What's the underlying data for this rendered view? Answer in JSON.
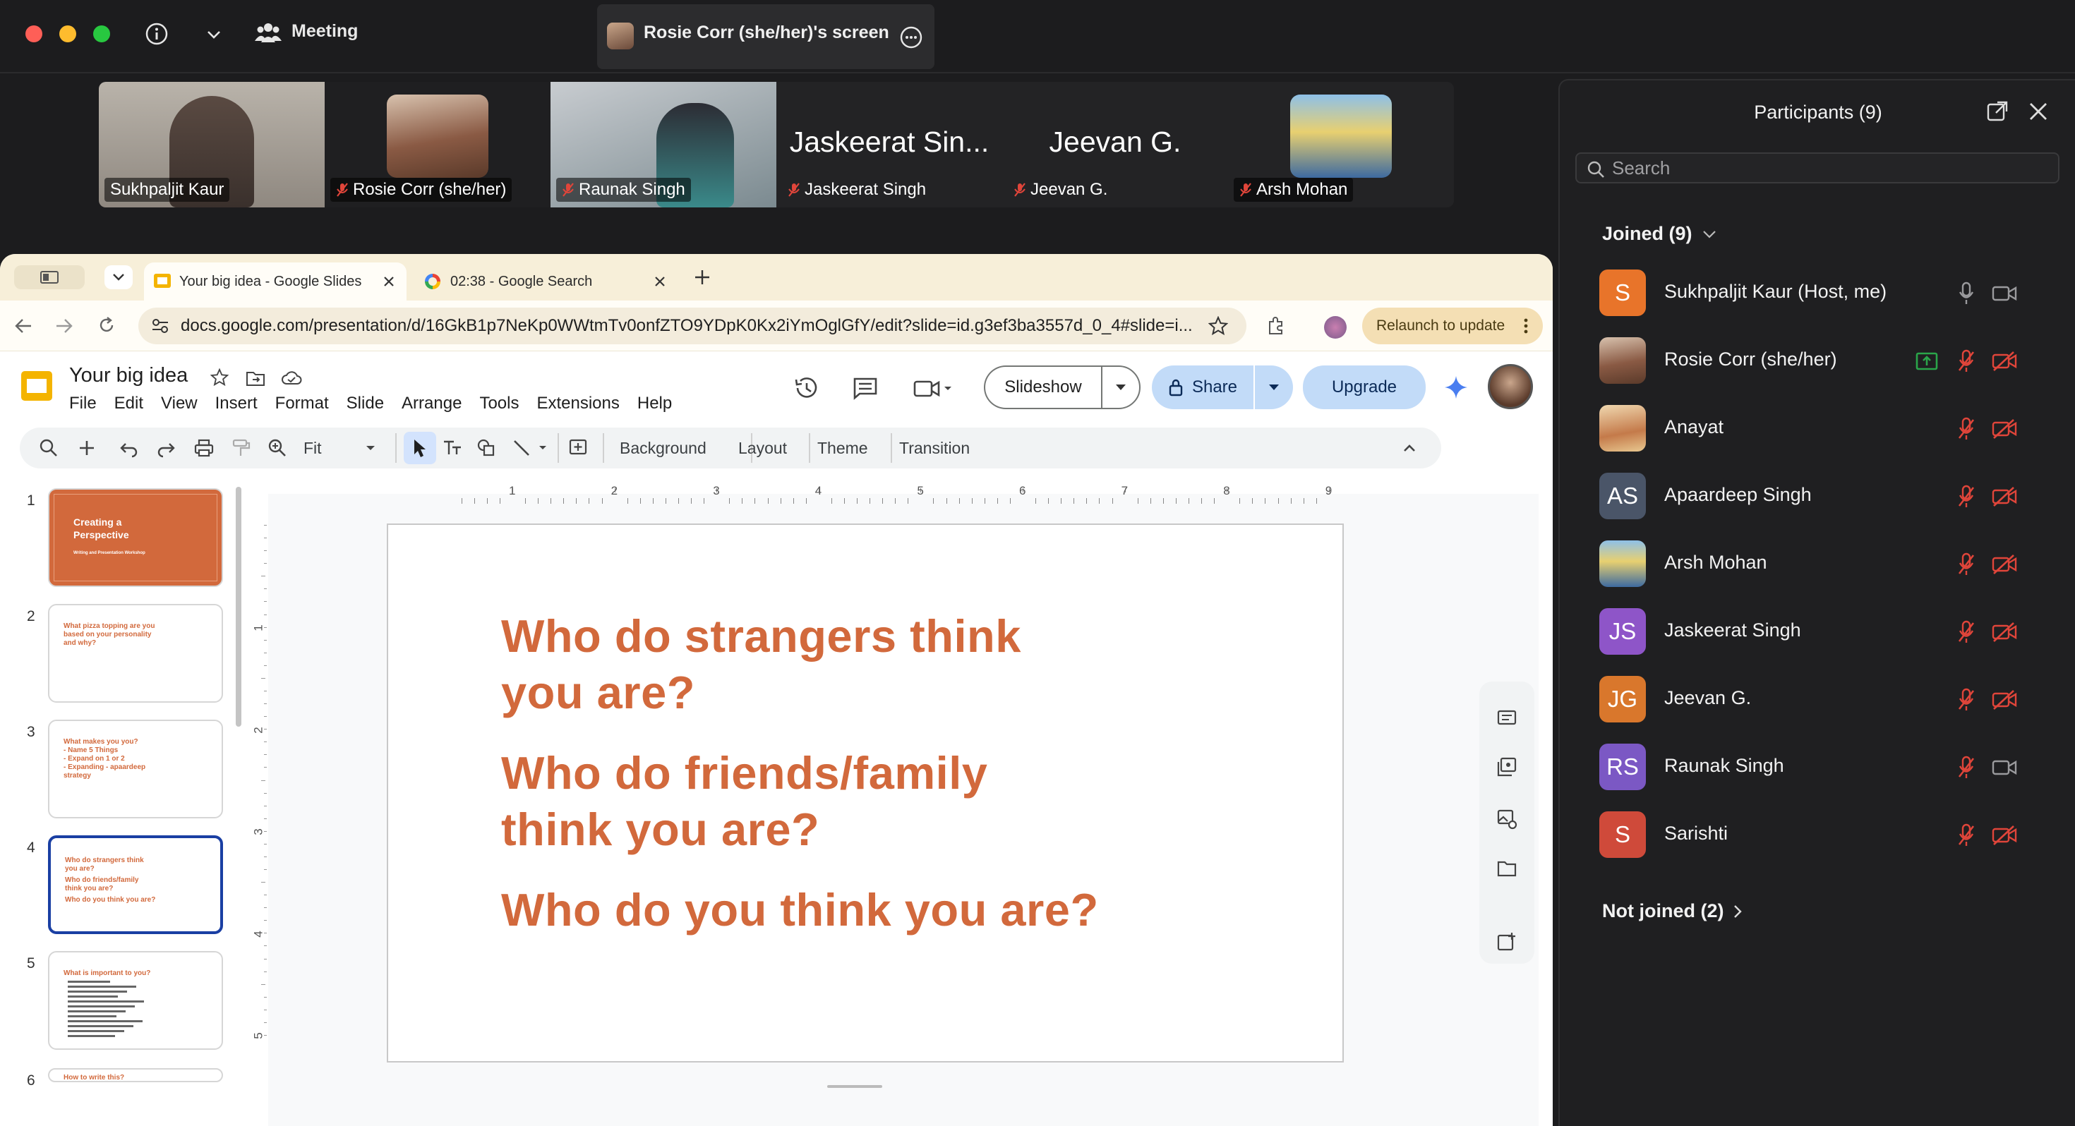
{
  "zoom": {
    "meeting_label": "Meeting",
    "share_tab_label": "Rosie Corr (she/her)'s screen",
    "colors": {
      "bg": "#1c1c1e",
      "mute_red": "#e0453a",
      "share_green": "#2aa54a"
    }
  },
  "video_tiles": [
    {
      "name": "Sukhpaljit Kaur",
      "muted": false,
      "type": "camera"
    },
    {
      "name": "Rosie Corr (she/her)",
      "muted": true,
      "type": "photo"
    },
    {
      "name": "Raunak Singh",
      "muted": true,
      "type": "camera"
    },
    {
      "name": "Jaskeerat Singh",
      "big_label": "Jaskeerat Sin...",
      "muted": true,
      "type": "name"
    },
    {
      "name": "Jeevan G.",
      "big_label": "Jeevan G.",
      "muted": true,
      "type": "name"
    },
    {
      "name": "Arsh Mohan",
      "muted": true,
      "type": "photo"
    }
  ],
  "participants_panel": {
    "title": "Participants (9)",
    "search_placeholder": "Search",
    "joined_label": "Joined (9)",
    "not_joined_label": "Not joined (2)",
    "items": [
      {
        "initials": "S",
        "name": "Sukhpaljit Kaur (Host, me)",
        "color": "#e8742a",
        "mic": "on",
        "video": "on",
        "sharing": false
      },
      {
        "initials": "",
        "name": "Rosie Corr (she/her)",
        "color": "#7a5a4a",
        "mic": "muted",
        "video": "off",
        "sharing": true
      },
      {
        "initials": "",
        "name": "Anayat",
        "color": "#c9a06a",
        "mic": "muted",
        "video": "off",
        "sharing": false
      },
      {
        "initials": "AS",
        "name": "Apaardeep Singh",
        "color": "#4a5568",
        "mic": "muted",
        "video": "off",
        "sharing": false
      },
      {
        "initials": "",
        "name": "Arsh Mohan",
        "color": "#5b7fa8",
        "mic": "muted",
        "video": "off",
        "sharing": false
      },
      {
        "initials": "JS",
        "name": "Jaskeerat Singh",
        "color": "#8e55c8",
        "mic": "muted",
        "video": "off",
        "sharing": false
      },
      {
        "initials": "JG",
        "name": "Jeevan G.",
        "color": "#d9772c",
        "mic": "muted",
        "video": "off",
        "sharing": false
      },
      {
        "initials": "RS",
        "name": "Raunak Singh",
        "color": "#7b58c4",
        "mic": "muted",
        "video": "on",
        "sharing": false
      },
      {
        "initials": "S",
        "name": "Sarishti",
        "color": "#cf4a3a",
        "mic": "muted",
        "video": "off",
        "sharing": false
      }
    ]
  },
  "browser": {
    "tabs": [
      {
        "title": "Your big idea - Google Slides",
        "active": true
      },
      {
        "title": "02:38 - Google Search",
        "active": false
      }
    ],
    "url": "docs.google.com/presentation/d/16GkB1p7NeKp0WWtmTv0onfZTO9YDpK0Kx2iYmOglGfY/edit?slide=id.g3ef3ba3557d_0_4#slide=i...",
    "relaunch_label": "Relaunch to update"
  },
  "slides_app": {
    "doc_title": "Your big idea",
    "menu": [
      "File",
      "Edit",
      "View",
      "Insert",
      "Format",
      "Slide",
      "Arrange",
      "Tools",
      "Extensions",
      "Help"
    ],
    "slideshow_label": "Slideshow",
    "share_label": "Share",
    "upgrade_label": "Upgrade",
    "zoom_label": "Fit",
    "toolbar_text": [
      "Background",
      "Layout",
      "Theme",
      "Transition"
    ],
    "accent": "#d2693c",
    "ruler_h": [
      "1",
      "2",
      "3",
      "4",
      "5",
      "6",
      "7",
      "8",
      "9"
    ],
    "ruler_v": [
      "1",
      "2",
      "3",
      "4",
      "5"
    ],
    "thumbnails": [
      {
        "num": "1",
        "lines": [
          "Creating a",
          "Perspective",
          "Writing and Presentation Workshop"
        ],
        "style": "cover"
      },
      {
        "num": "2",
        "lines": [
          "What pizza topping are you",
          "based on your personality",
          "and why?"
        ],
        "style": "text"
      },
      {
        "num": "3",
        "lines": [
          "What makes you you?",
          "- Name 5 Things",
          "- Expand on 1 or 2",
          "- Expanding - apaardeep",
          "  strategy"
        ],
        "style": "text"
      },
      {
        "num": "4",
        "lines": [
          "Who do strangers think",
          "you are?",
          "Who do friends/family",
          "think you are?",
          "Who do you think you are?"
        ],
        "style": "text"
      },
      {
        "num": "5",
        "lines": [
          "What is important to you?"
        ],
        "style": "list"
      },
      {
        "num": "6",
        "lines": [
          "How to write this?"
        ],
        "style": "text"
      }
    ],
    "slide_text": [
      "Who do strangers think",
      "you are?",
      "Who do friends/family",
      "think you are?",
      "Who do you think you are?"
    ]
  }
}
